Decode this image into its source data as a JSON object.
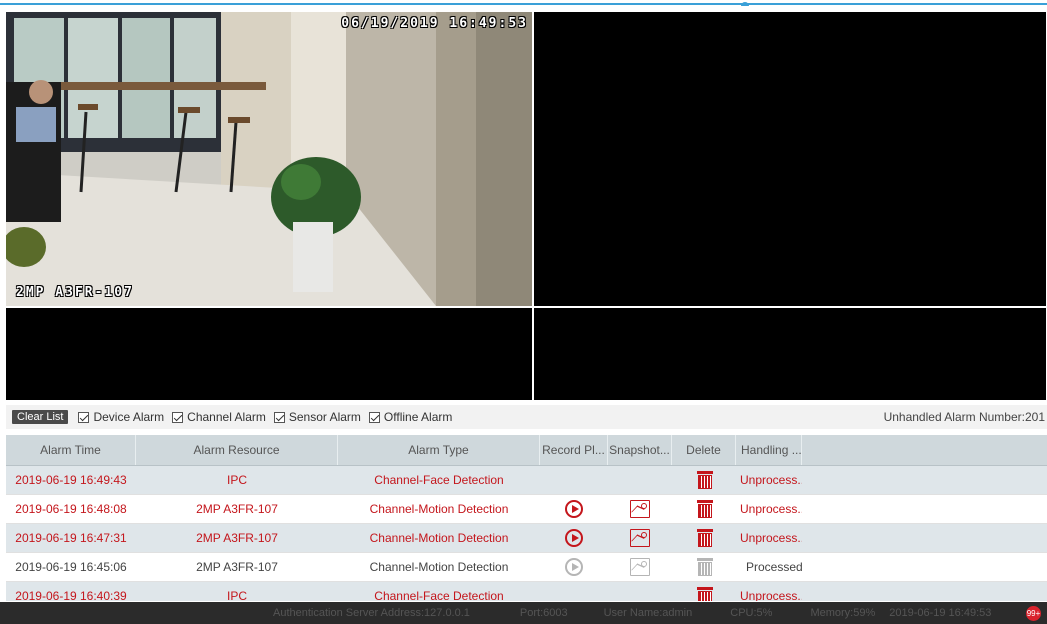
{
  "video": {
    "tile1_timestamp": "06/19/2019  16:49:53",
    "tile1_camera": "2MP A3FR-107"
  },
  "alarm_bar": {
    "clear_label": "Clear List",
    "filters": [
      "Device Alarm",
      "Channel Alarm",
      "Sensor Alarm",
      "Offline Alarm"
    ],
    "unhandled_label": "Unhandled Alarm Number:201"
  },
  "table": {
    "headers": [
      "Alarm Time",
      "Alarm Resource",
      "Alarm Type",
      "Record Pl...",
      "Snapshot...",
      "Delete",
      "Handling ...",
      ""
    ],
    "rows": [
      {
        "time": "2019-06-19 16:49:43",
        "resource": "IPC",
        "type": "Channel-Face Detection",
        "record": false,
        "snapshot": false,
        "status": "Unprocess...",
        "handled": false
      },
      {
        "time": "2019-06-19 16:48:08",
        "resource": "2MP A3FR-107",
        "type": "Channel-Motion Detection",
        "record": true,
        "snapshot": true,
        "status": "Unprocess...",
        "handled": false
      },
      {
        "time": "2019-06-19 16:47:31",
        "resource": "2MP A3FR-107",
        "type": "Channel-Motion Detection",
        "record": true,
        "snapshot": true,
        "status": "Unprocess...",
        "handled": false
      },
      {
        "time": "2019-06-19 16:45:06",
        "resource": "2MP A3FR-107",
        "type": "Channel-Motion Detection",
        "record": true,
        "snapshot": true,
        "status": "Processed",
        "handled": true
      },
      {
        "time": "2019-06-19 16:40:39",
        "resource": "IPC",
        "type": "Channel-Face Detection",
        "record": false,
        "snapshot": false,
        "status": "Unprocess...",
        "handled": false
      }
    ]
  },
  "status_bar": {
    "auth": "Authentication Server Address:127.0.0.1",
    "port": "Port:6003",
    "user": "User Name:admin",
    "cpu": "CPU:5%",
    "memory": "Memory:59%",
    "datetime": "2019-06-19 16:49:53",
    "badge": "99+"
  },
  "colors": {
    "accent": "#3aa0d8",
    "alarm_red": "#c4161c",
    "header_bg": "#cfd8dc",
    "status_bg": "#2b2b2b"
  }
}
